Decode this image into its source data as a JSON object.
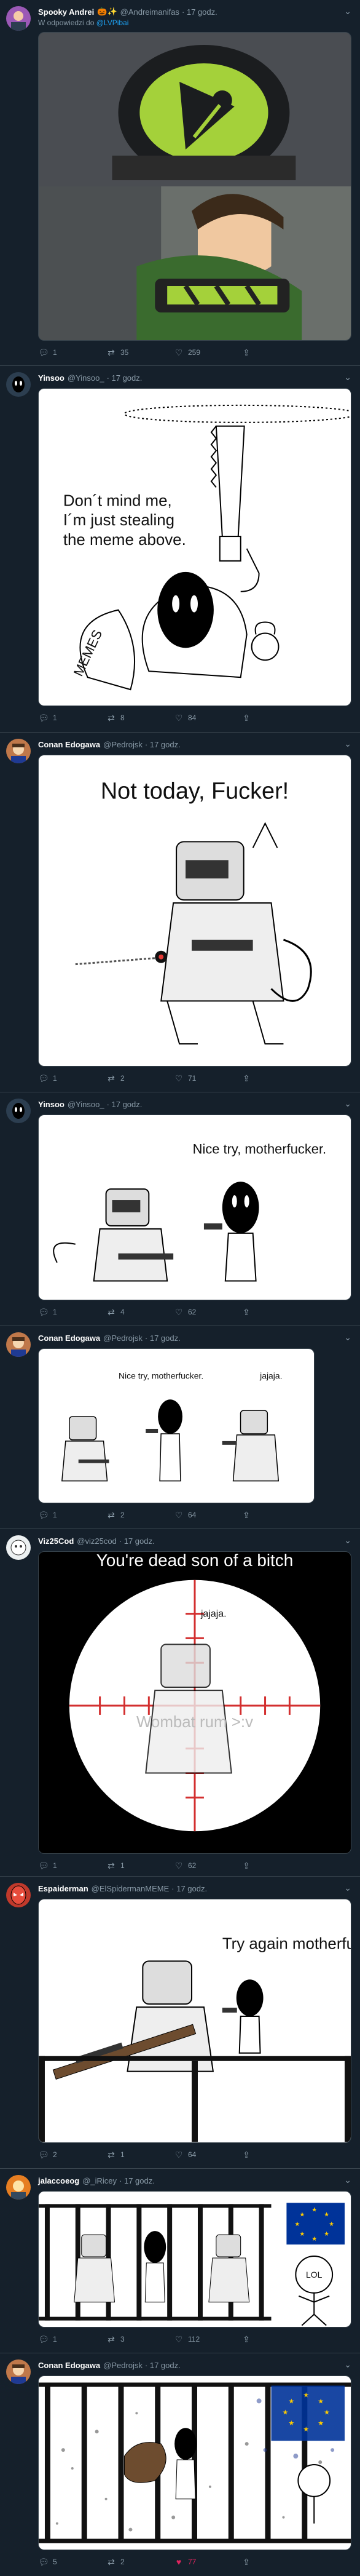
{
  "tweets": [
    {
      "name": "Spooky Andrei",
      "emoji": "🎃✨",
      "handle": "@Andreimanifas",
      "time": "· 17 godz.",
      "reply_prefix": "W odpowiedzi do",
      "reply_mention": "@LVPibai",
      "replies": "1",
      "retweets": "35",
      "likes": "259",
      "avatar_color": "#9b59b6"
    },
    {
      "name": "Yinsoo",
      "handle": "@Yinsoo_",
      "time": "· 17 godz.",
      "caption": [
        "Don´t mind me,",
        "I´m just stealing",
        "the meme above."
      ],
      "sack_label": "MEMES",
      "replies": "1",
      "retweets": "8",
      "likes": "84",
      "avatar_color": "#2c3e50"
    },
    {
      "name": "Conan Edogawa",
      "handle": "@Pedrojsk",
      "time": "· 17 godz.",
      "caption": "Not today, Fucker!",
      "replies": "1",
      "retweets": "2",
      "likes": "71",
      "avatar_color": "#c0784a"
    },
    {
      "name": "Yinsoo",
      "handle": "@Yinsoo_",
      "time": "· 17 godz.",
      "caption": "Nice try, motherfucker.",
      "replies": "1",
      "retweets": "4",
      "likes": "62",
      "avatar_color": "#2c3e50"
    },
    {
      "name": "Conan Edogawa",
      "handle": "@Pedrojsk",
      "time": "· 17 godz.",
      "caption": "Nice try, motherfucker.",
      "caption2": "jajaja.",
      "replies": "1",
      "retweets": "2",
      "likes": "64",
      "avatar_color": "#c0784a"
    },
    {
      "name": "Viz25Cod",
      "handle": "@viz25cod",
      "time": "· 17 godz.",
      "caption": "You're dead son of a bitch",
      "label1": "jajaja.",
      "label2": "Wombat rum >:v",
      "replies": "1",
      "retweets": "1",
      "likes": "62",
      "avatar_color": "#ecf0f1"
    },
    {
      "name": "Espaiderman",
      "handle": "@ElSpidermanMEME",
      "time": "· 17 godz.",
      "caption": "Try again motherfucker",
      "replies": "2",
      "retweets": "1",
      "likes": "64",
      "avatar_color": "#c0392b"
    },
    {
      "name": "jalaccoeog",
      "handle": "@_iRicey",
      "time": "· 17 godz.",
      "caption": "LOL",
      "replies": "1",
      "retweets": "3",
      "likes": "112",
      "avatar_color": "#e67e22"
    },
    {
      "name": "Conan Edogawa",
      "handle": "@Pedrojsk",
      "time": "· 17 godz.",
      "replies": "5",
      "retweets": "2",
      "likes": "77",
      "avatar_color": "#c0784a"
    }
  ],
  "colors": {
    "background": "#15202b",
    "accent": "#1da1f2",
    "like_active": "#e0245e",
    "muted": "#8899a6"
  },
  "icons": {
    "reply": "reply-icon",
    "retweet": "retweet-icon",
    "like": "heart-icon",
    "share": "share-icon",
    "menu": "chevron-down-icon"
  }
}
